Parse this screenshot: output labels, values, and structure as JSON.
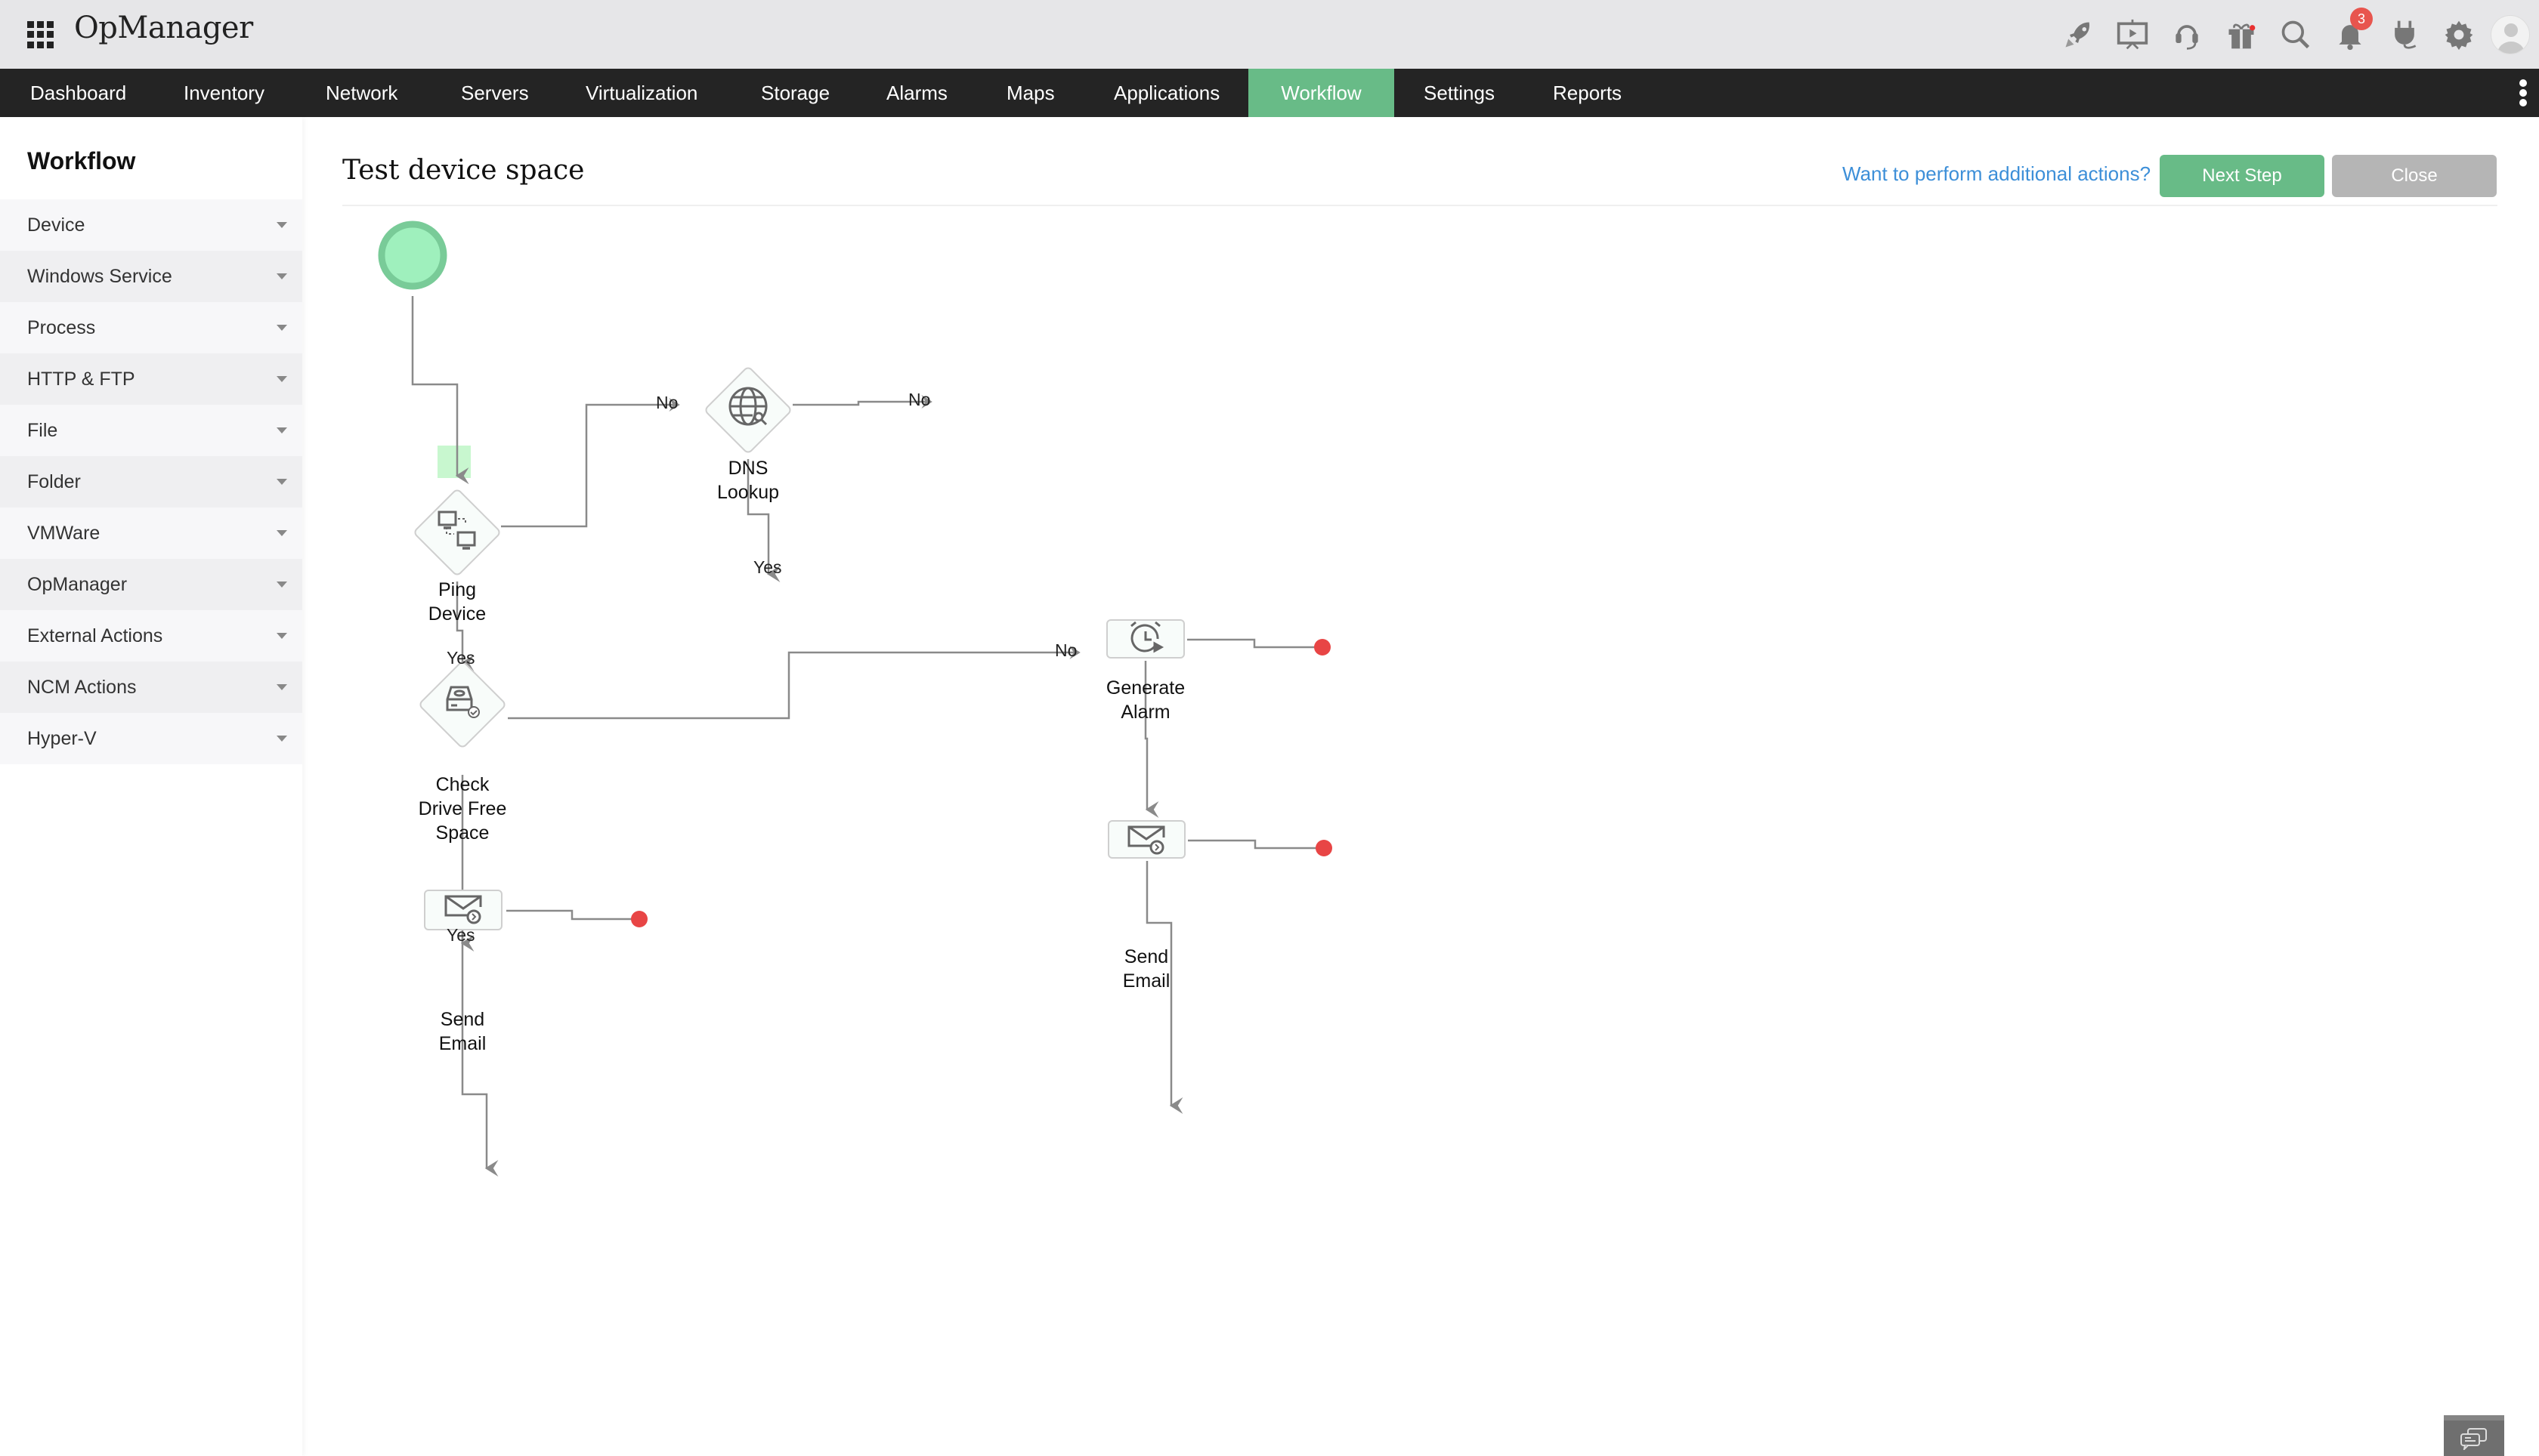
{
  "app": {
    "title": "OpManager",
    "notification_count": "3"
  },
  "header_icons": [
    "rocket-icon",
    "presentation-icon",
    "headset-icon",
    "gift-icon",
    "search-icon",
    "bell-icon",
    "plug-icon",
    "gear-icon",
    "avatar"
  ],
  "nav": {
    "tabs": [
      {
        "label": "Dashboard"
      },
      {
        "label": "Inventory"
      },
      {
        "label": "Network"
      },
      {
        "label": "Servers"
      },
      {
        "label": "Virtualization"
      },
      {
        "label": "Storage"
      },
      {
        "label": "Alarms"
      },
      {
        "label": "Maps"
      },
      {
        "label": "Applications"
      },
      {
        "label": "Workflow",
        "active": true
      },
      {
        "label": "Settings"
      },
      {
        "label": "Reports"
      }
    ]
  },
  "sidebar": {
    "title": "Workflow",
    "items": [
      {
        "label": "Device"
      },
      {
        "label": "Windows Service"
      },
      {
        "label": "Process"
      },
      {
        "label": "HTTP & FTP"
      },
      {
        "label": "File"
      },
      {
        "label": "Folder"
      },
      {
        "label": "VMWare"
      },
      {
        "label": "OpManager"
      },
      {
        "label": "External Actions"
      },
      {
        "label": "NCM Actions"
      },
      {
        "label": "Hyper-V"
      }
    ]
  },
  "main": {
    "title": "Test device space",
    "additional_actions_link": "Want to perform additional actions?",
    "next_step_label": "Next Step",
    "close_label": "Close"
  },
  "workflow": {
    "nodes": [
      {
        "id": "start",
        "type": "start"
      },
      {
        "id": "ping",
        "type": "check",
        "label_lines": [
          "Ping",
          "Device"
        ],
        "icon": "network-devices-icon"
      },
      {
        "id": "dns",
        "type": "check",
        "label_lines": [
          "DNS",
          "Lookup"
        ],
        "icon": "globe-search-icon"
      },
      {
        "id": "drive",
        "type": "check",
        "label_lines": [
          "Check",
          "Drive Free",
          "Space"
        ],
        "icon": "drive-check-icon"
      },
      {
        "id": "email1",
        "type": "action",
        "label_lines": [
          "Send",
          "Email"
        ],
        "icon": "email-send-icon"
      },
      {
        "id": "alarm",
        "type": "action",
        "label_lines": [
          "Generate",
          "Alarm"
        ],
        "icon": "alarm-clock-icon"
      },
      {
        "id": "email2",
        "type": "action",
        "label_lines": [
          "Send",
          "Email"
        ],
        "icon": "email-send-icon"
      }
    ],
    "edge_labels": {
      "ping_no": "No",
      "dns_no": "No",
      "dns_yes": "Yes",
      "ping_yes": "Yes",
      "drive_no": "No",
      "drive_yes": "Yes"
    },
    "colors": {
      "start_fill": "#9ff0bd",
      "start_stroke": "#79cb98",
      "end_dot": "#e84545",
      "line": "#8a8a8a",
      "active": "#68bb87"
    }
  }
}
